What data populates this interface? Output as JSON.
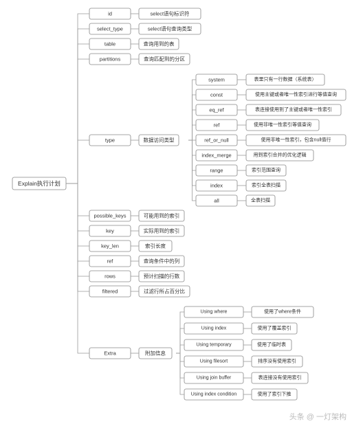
{
  "root": {
    "label": "Explain执行计划"
  },
  "cols": [
    {
      "key": "id",
      "label": "id",
      "desc": "select语句标识符"
    },
    {
      "key": "select_type",
      "label": "select_type",
      "desc": "select语句查询类型"
    },
    {
      "key": "table",
      "label": "table",
      "desc": "查询用到的表"
    },
    {
      "key": "partitions",
      "label": "partitions",
      "desc": "查询匹配到的分区"
    },
    {
      "key": "type",
      "label": "type",
      "desc": "数据访问类型"
    },
    {
      "key": "possible_keys",
      "label": "possible_keys",
      "desc": "可能用到的索引"
    },
    {
      "key": "key",
      "label": "key",
      "desc": "实际用到的索引"
    },
    {
      "key": "key_len",
      "label": "key_len",
      "desc": "索引长度"
    },
    {
      "key": "ref",
      "label": "ref",
      "desc": "查询条件中的列"
    },
    {
      "key": "rows",
      "label": "rows",
      "desc": "预计扫描的行数"
    },
    {
      "key": "filtered",
      "label": "filtered",
      "desc": "过滤行所占百分比"
    },
    {
      "key": "Extra",
      "label": "Extra",
      "desc": "附加信息"
    }
  ],
  "type_values": [
    {
      "label": "system",
      "desc": "表里只有一行数据（系统表）"
    },
    {
      "label": "const",
      "desc": "使用主键或者唯一性索引进行等值查询"
    },
    {
      "label": "eq_ref",
      "desc": "表连接使用到了主键或者唯一性索引"
    },
    {
      "label": "ref",
      "desc": "使用非唯一性索引等值查询"
    },
    {
      "label": "ref_or_null",
      "desc": "使用非唯一性索引，包含null值行"
    },
    {
      "label": "index_merge",
      "desc": "用到索引合并的优化逻辑"
    },
    {
      "label": "range",
      "desc": "索引范围查询"
    },
    {
      "label": "index",
      "desc": "索引全表扫描"
    },
    {
      "label": "all",
      "desc": "全表扫描"
    }
  ],
  "extra_values": [
    {
      "label": "Using where",
      "desc": "使用了where条件"
    },
    {
      "label": "Using index",
      "desc": "使用了覆盖索引"
    },
    {
      "label": "Using temporary",
      "desc": "使用了临时表"
    },
    {
      "label": "Using filesort",
      "desc": "排序没有使用索引"
    },
    {
      "label": "Using join buffer",
      "desc": "表连接没有使用索引"
    },
    {
      "label": "Using index condition",
      "desc": "使用了索引下推"
    }
  ],
  "watermark": "头条 @ 一灯架构"
}
